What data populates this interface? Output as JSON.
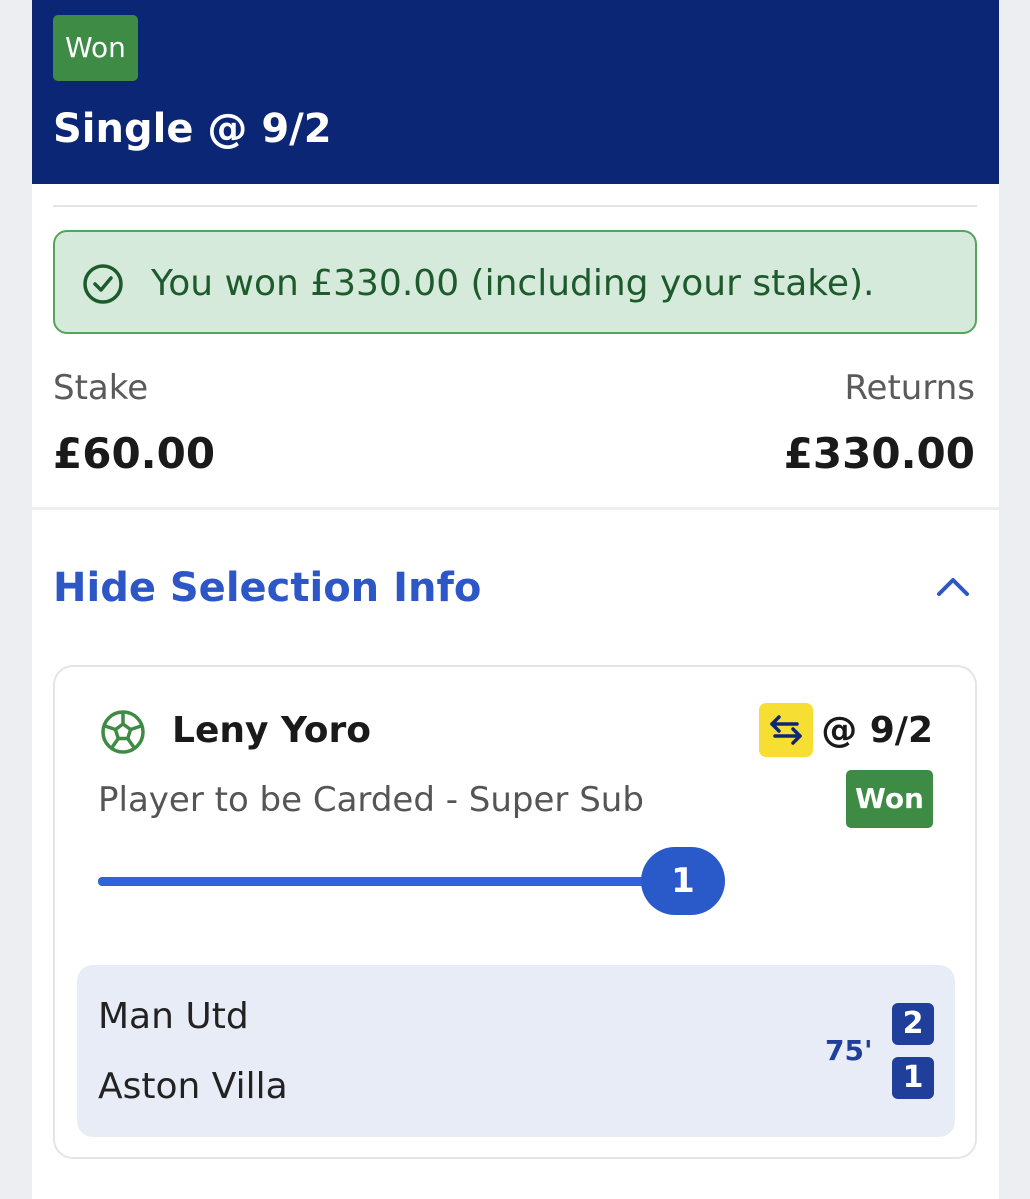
{
  "header": {
    "status_badge": "Won",
    "title": "Single @ 9/2"
  },
  "win_banner": {
    "text": "You won £330.00 (including your stake)."
  },
  "summary": {
    "stake_label": "Stake",
    "stake_value": "£60.00",
    "returns_label": "Returns",
    "returns_value": "£330.00"
  },
  "toggle": {
    "label": "Hide Selection Info",
    "icon": "chevron-up-icon"
  },
  "selection": {
    "sport_icon": "football-icon",
    "player": "Leny Yoro",
    "odds": "@ 9/2",
    "swap_icon": "swap-icon",
    "market": "Player to be Carded - Super Sub",
    "status_badge": "Won",
    "progress": {
      "value": 1,
      "fraction": 1.0
    },
    "match": {
      "home_team": "Man Utd",
      "away_team": "Aston Villa",
      "time": "75'",
      "home_score": "2",
      "away_score": "1"
    }
  },
  "colors": {
    "header_bg": "#0b2674",
    "won_badge": "#3d8b45",
    "win_banner_bg": "#d6eadb",
    "accent_blue": "#2d56c6",
    "swap_yellow": "#f7de33"
  }
}
